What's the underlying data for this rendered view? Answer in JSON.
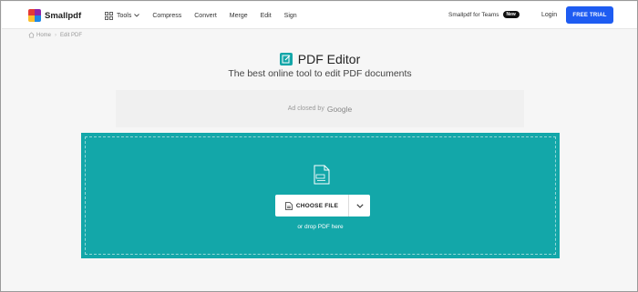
{
  "header": {
    "brand": "Smallpdf",
    "nav": {
      "tools": "Tools",
      "compress": "Compress",
      "convert": "Convert",
      "merge": "Merge",
      "edit": "Edit",
      "sign": "Sign"
    },
    "teams_label": "Smallpdf for Teams",
    "teams_badge": "New",
    "login": "Login",
    "trial": "FREE TRIAL"
  },
  "breadcrumb": {
    "home": "Home",
    "separator": "›",
    "current": "Edit PDF"
  },
  "main": {
    "title": "PDF Editor",
    "subtitle": "The best online tool to edit PDF documents"
  },
  "ad": {
    "text": "Ad closed by",
    "brand": "Google"
  },
  "upload": {
    "choose_label": "CHOOSE FILE",
    "drop_text": "or drop PDF here"
  },
  "colors": {
    "accent": "#13a7a9",
    "trial": "#1e5cf2",
    "background": "#f6f6f6"
  },
  "icons": [
    "grid-icon",
    "chevron-down-icon",
    "home-icon",
    "edit-icon",
    "pdf-file-icon",
    "file-icon"
  ]
}
